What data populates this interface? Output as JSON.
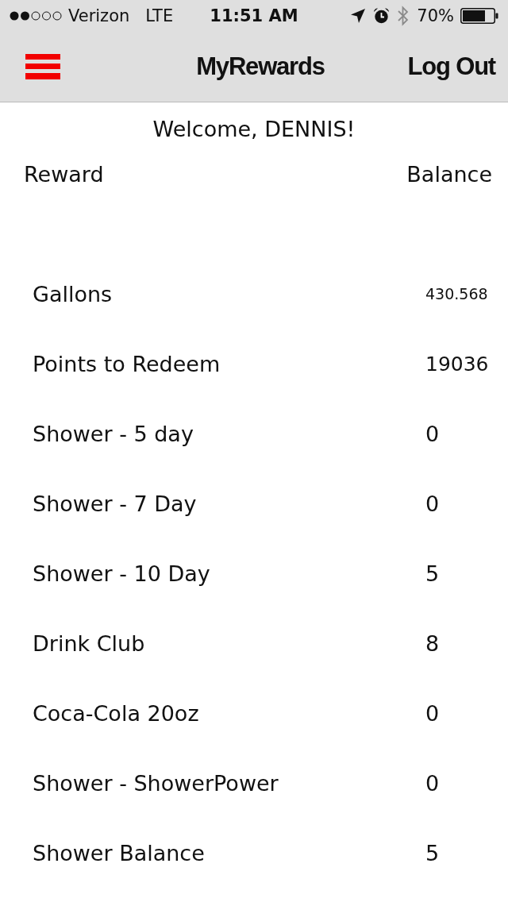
{
  "status_bar": {
    "carrier": "Verizon",
    "network": "LTE",
    "time": "11:51 AM",
    "battery": "70%"
  },
  "nav_bar": {
    "title": "MyRewards",
    "action": "Log Out"
  },
  "welcome": "Welcome, DENNIS!",
  "table": {
    "columns": [
      "Reward",
      "Balance"
    ],
    "rows": [
      {
        "reward": "Gallons",
        "balance": "430.568"
      },
      {
        "reward": "Points to Redeem",
        "balance": "19036"
      },
      {
        "reward": "Shower - 5 day",
        "balance": "0"
      },
      {
        "reward": "Shower - 7 Day",
        "balance": "0"
      },
      {
        "reward": "Shower - 10 Day",
        "balance": "5"
      },
      {
        "reward": "Drink Club",
        "balance": "8"
      },
      {
        "reward": "Coca-Cola 20oz",
        "balance": "0"
      },
      {
        "reward": "Shower - ShowerPower",
        "balance": "0"
      },
      {
        "reward": "Shower Balance",
        "balance": "5"
      }
    ]
  }
}
